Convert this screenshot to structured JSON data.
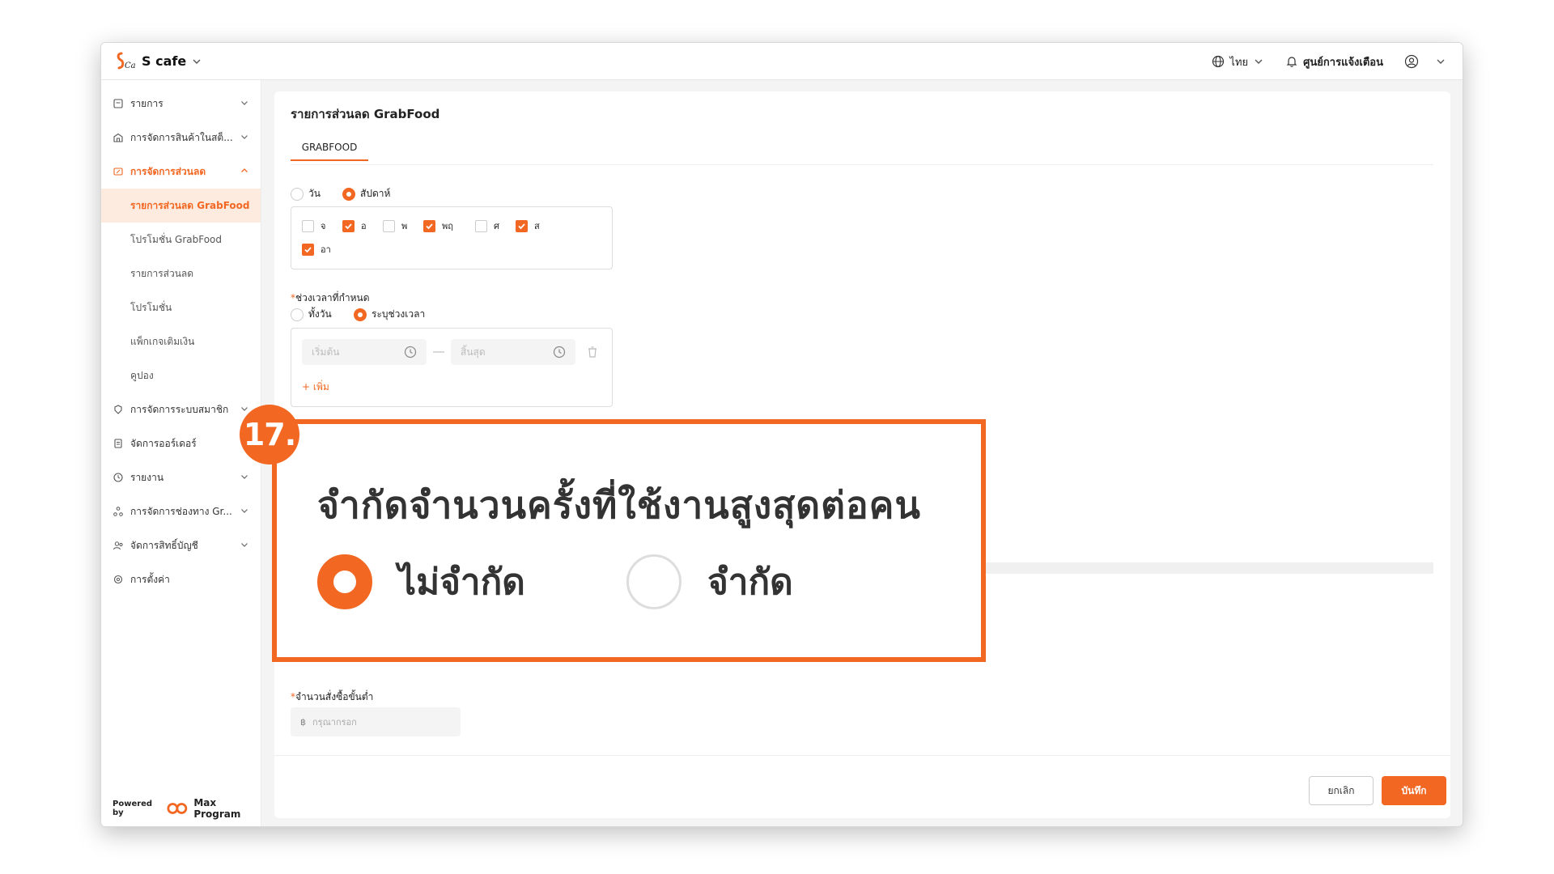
{
  "app": {
    "brand_name": "S cafe",
    "language": "ไทย",
    "notifications_label": "ศูนย์การแจ้งเตือน",
    "accent_color": "#f26722"
  },
  "sidebar": {
    "items": [
      {
        "label": "รายการ",
        "icon": "list-icon"
      },
      {
        "label": "การจัดการสินค้าในสต็...",
        "icon": "store-icon"
      },
      {
        "label": "การจัดการส่วนลด",
        "icon": "discount-icon"
      },
      {
        "label": "การจัดการระบบสมาชิก",
        "icon": "member-icon"
      },
      {
        "label": "จัดการออร์เดอร์",
        "icon": "order-icon"
      },
      {
        "label": "รายงาน",
        "icon": "report-icon"
      },
      {
        "label": "การจัดการช่องทาง Gr...",
        "icon": "channel-icon"
      },
      {
        "label": "จัดการสิทธิ์บัญชี",
        "icon": "account-icon"
      },
      {
        "label": "การตั้งค่า",
        "icon": "settings-icon"
      }
    ],
    "sub_items": [
      {
        "label": "รายการส่วนลด GrabFood"
      },
      {
        "label": "โปรโมชั่น GrabFood"
      },
      {
        "label": "รายการส่วนลด"
      },
      {
        "label": "โปรโมชั่น"
      },
      {
        "label": "แพ็กเกจเติมเงิน"
      },
      {
        "label": "คูปอง"
      }
    ],
    "powered_by": "Powered by",
    "powered_brand": "Max Program"
  },
  "main": {
    "title": "รายการส่วนลด GrabFood",
    "tab": "GRABFOOD",
    "period_options": [
      "วัน",
      "สัปดาห์"
    ],
    "days": [
      {
        "label": "จ",
        "checked": false
      },
      {
        "label": "อ",
        "checked": true
      },
      {
        "label": "พ",
        "checked": false
      },
      {
        "label": "พฤ",
        "checked": true
      },
      {
        "label": "ศ",
        "checked": false
      },
      {
        "label": "ส",
        "checked": true
      },
      {
        "label": "อา",
        "checked": true
      }
    ],
    "time_range_label": "ช่วงเวลาที่กำหนด",
    "time_options": [
      "ทั้งวัน",
      "ระบุช่วงเวลา"
    ],
    "start_placeholder": "เริ่มต้น",
    "end_placeholder": "สิ้นสุด",
    "add_label": "+ เพิ่ม",
    "min_order_label": "จำนวนสั่งซื้อขั้นต่ำ",
    "currency_symbol": "฿",
    "min_order_placeholder": "กรุณากรอก",
    "cancel_label": "ยกเลิก",
    "save_label": "บันทึก"
  },
  "callout": {
    "step": "17.",
    "title": "จำกัดจำนวนครั้งที่ใช้งานสูงสุดต่อคน",
    "options": [
      "ไม่จำกัด",
      "จำกัด"
    ]
  }
}
